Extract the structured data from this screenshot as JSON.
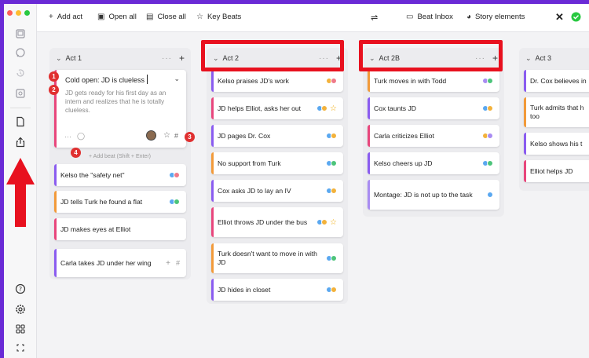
{
  "toolbar": {
    "add_act": "Add act",
    "open_all": "Open all",
    "close_all": "Close all",
    "key_beats": "Key Beats",
    "beat_inbox": "Beat Inbox",
    "story_elements": "Story elements"
  },
  "columns": [
    {
      "title": "Act 1",
      "expanded_card": {
        "title": "Cold open: JD is clueless",
        "description": "JD gets ready for his first day as an intern and realizes that he is totally clueless.",
        "add_beat_hint": "Add beat (Shift + Enter)"
      },
      "cards": [
        {
          "text": "Kelso the \"safety net\""
        },
        {
          "text": "JD tells Turk he found a flat"
        },
        {
          "text": "JD makes eyes at Elliot"
        },
        {
          "text": "Carla takes JD under her wing"
        }
      ]
    },
    {
      "title": "Act 2",
      "cards": [
        {
          "text": "Kelso praises JD's work"
        },
        {
          "text": "JD helps Elliot, asks her out"
        },
        {
          "text": "JD pages Dr. Cox"
        },
        {
          "text": "No support from Turk"
        },
        {
          "text": "Cox asks JD to lay an IV"
        },
        {
          "text": "Elliot throws JD under the bus"
        },
        {
          "text": "Turk doesn't want to move in with JD"
        },
        {
          "text": "JD hides in closet"
        }
      ]
    },
    {
      "title": "Act 2B",
      "cards": [
        {
          "text": "Turk moves in with Todd"
        },
        {
          "text": "Cox taunts JD"
        },
        {
          "text": "Carla criticizes Elliot"
        },
        {
          "text": "Kelso cheers up JD"
        },
        {
          "text": "Montage: JD is not up to the task"
        }
      ]
    },
    {
      "title": "Act 3",
      "cards": [
        {
          "text": "Dr. Cox believes in"
        },
        {
          "text": "Turk admits that h too"
        },
        {
          "text": "Kelso shows his t"
        },
        {
          "text": "Elliot helps JD"
        }
      ]
    }
  ],
  "badges": [
    "1",
    "2",
    "3",
    "4"
  ],
  "colors": {
    "accent_red": "#e8111f",
    "window_border": "#6a2ad6",
    "bar_purple": "#8a5cf0",
    "bar_pink": "#e8467c",
    "bar_orange": "#f29a3a",
    "dot_blue": "#5aa8f0",
    "dot_green": "#4cc47a",
    "dot_orange": "#f3b23b",
    "dot_purple": "#a98cf2",
    "dot_pink": "#ef7a8a"
  }
}
